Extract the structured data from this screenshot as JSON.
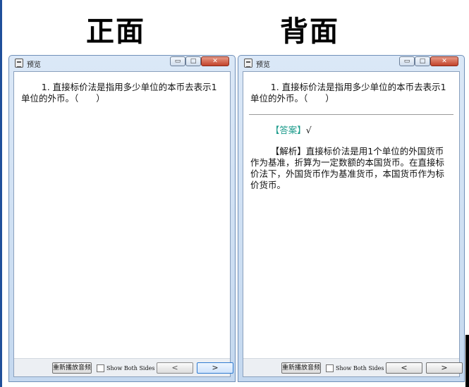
{
  "headings": {
    "front": "正面",
    "back": "背面"
  },
  "window": {
    "title": "预览",
    "controls": {
      "minimize": "▭",
      "maximize": "□",
      "close": "✕"
    }
  },
  "front": {
    "question": "1. 直接标价法是指用多少单位的本币去表示1单位的外币。（　　）"
  },
  "back": {
    "question": "1. 直接标价法是指用多少单位的本币去表示1单位的外币。（　　）",
    "answer_tag": "【答案】",
    "answer_value": "√",
    "analysis": "【解析】直接标价法是用1个单位的外国货币作为基准，折算为一定数额的本国货币。在直接标价法下，外国货币作为基准货币，本国货币作为标价货币。"
  },
  "footer": {
    "replay_label": "重新播放音频",
    "show_both_sides_label": "Show Both Sides",
    "show_both_sides_checked": false,
    "prev_label": "<",
    "next_label": ">"
  }
}
